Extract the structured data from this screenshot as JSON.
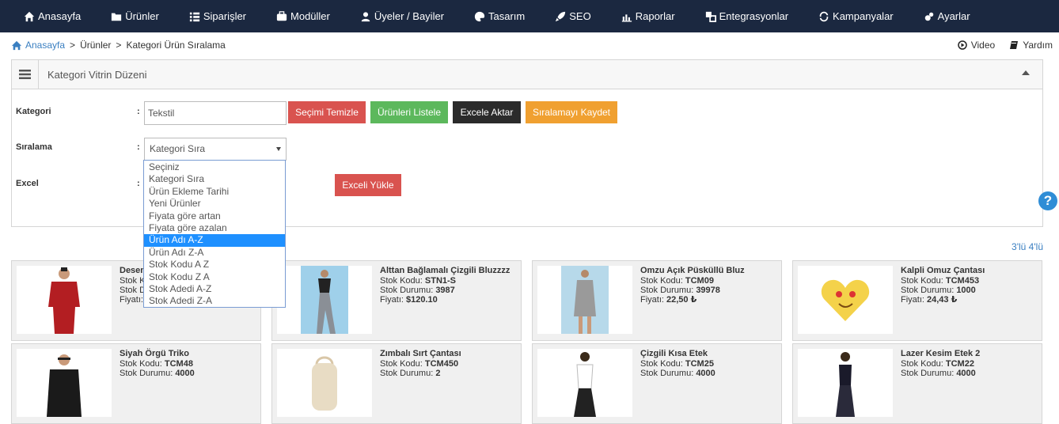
{
  "nav": [
    {
      "label": "Anasayfa",
      "icon": "home-icon"
    },
    {
      "label": "Ürünler",
      "icon": "folder-icon"
    },
    {
      "label": "Siparişler",
      "icon": "list-icon"
    },
    {
      "label": "Modüller",
      "icon": "modules-icon"
    },
    {
      "label": "Üyeler / Bayiler",
      "icon": "users-icon"
    },
    {
      "label": "Tasarım",
      "icon": "palette-icon"
    },
    {
      "label": "SEO",
      "icon": "rocket-icon"
    },
    {
      "label": "Raporlar",
      "icon": "chart-icon"
    },
    {
      "label": "Entegrasyonlar",
      "icon": "integration-icon"
    },
    {
      "label": "Kampanyalar",
      "icon": "campaign-icon"
    },
    {
      "label": "Ayarlar",
      "icon": "gear-icon"
    }
  ],
  "breadcrumb": {
    "home": "Anasayfa",
    "sep": ">",
    "level1": "Ürünler",
    "level2": "Kategori Ürün Sıralama"
  },
  "topright": {
    "video": "Video",
    "help": "Yardım"
  },
  "panel": {
    "title": "Kategori Vitrin Düzeni",
    "labels": {
      "category": "Kategori",
      "sort": "Sıralama",
      "excel": "Excel",
      "colon": ":"
    },
    "category_value": "Tekstil",
    "buttons": {
      "clear": "Seçimi Temizle",
      "list": "Ürünleri Listele",
      "export": "Excele Aktar",
      "save": "Sıralamayı Kaydet",
      "upload": "Exceli Yükle"
    },
    "sort_selected": "Kategori Sıra",
    "sort_options": [
      "Seçiniz",
      "Kategori Sıra",
      "Ürün Ekleme Tarihi",
      "Yeni Ürünler",
      "Fiyata göre artan",
      "Fiyata göre azalan",
      "Ürün Adı A-Z",
      "Ürün Adı Z-A",
      "Stok Kodu A Z",
      "Stok Kodu Z A",
      "Stok Adedi A-Z",
      "Stok Adedi Z-A"
    ],
    "highlighted_option": "Ürün Adı A-Z"
  },
  "view_toggle": "3'lü 4'lü",
  "labels": {
    "stock_code": "Stok Kodu:",
    "stock_qty": "Stok Durumu:",
    "price": "Fiyatı:"
  },
  "products": [
    {
      "name": "Desen",
      "code": "",
      "qty": "",
      "price": ""
    },
    {
      "name": "Alttan Bağlamalı Çizgili Bluzzzz",
      "code": "STN1-S",
      "qty": "3987",
      "price": "$120.10"
    },
    {
      "name": "Omzu Açık Püsküllü Bluz",
      "code": "TCM09",
      "qty": "39978",
      "price": "22,50 ₺"
    },
    {
      "name": "Kalpli Omuz Çantası",
      "code": "TCM453",
      "qty": "1000",
      "price": "24,43 ₺"
    },
    {
      "name": "Siyah Örgü Triko",
      "code": "TCM48",
      "qty": "4000",
      "price": ""
    },
    {
      "name": "Zımbalı Sırt Çantası",
      "code": "TCM450",
      "qty": "2",
      "price": ""
    },
    {
      "name": "Çizgili Kısa Etek",
      "code": "TCM25",
      "qty": "4000",
      "price": ""
    },
    {
      "name": "Lazer Kesim Etek 2",
      "code": "TCM22",
      "qty": "4000",
      "price": ""
    }
  ]
}
